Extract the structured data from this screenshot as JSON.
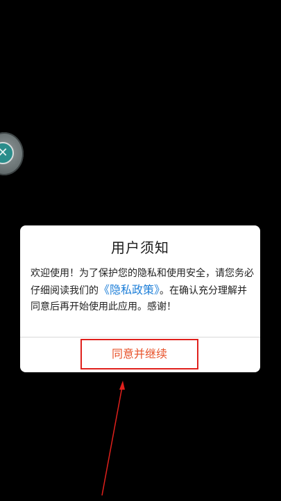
{
  "floating_ball": {
    "icon": "close-x-icon",
    "glyph": "✕"
  },
  "dialog": {
    "title": "用户须知",
    "body_part1": "欢迎使用！为了保护您的隐私和使用安全，请您务必仔细阅读我们的",
    "policy_link": "《隐私政策》",
    "body_part2": "。在确认充分理解并同意后再开始使用此应用。感谢！",
    "agree_button": "同意并继续"
  },
  "colors": {
    "background": "#000000",
    "dialog_bg": "#ffffff",
    "link": "#1e7fd8",
    "button_text": "#e8522a",
    "highlight_box": "#e0201c",
    "arrow": "#e0201c"
  }
}
